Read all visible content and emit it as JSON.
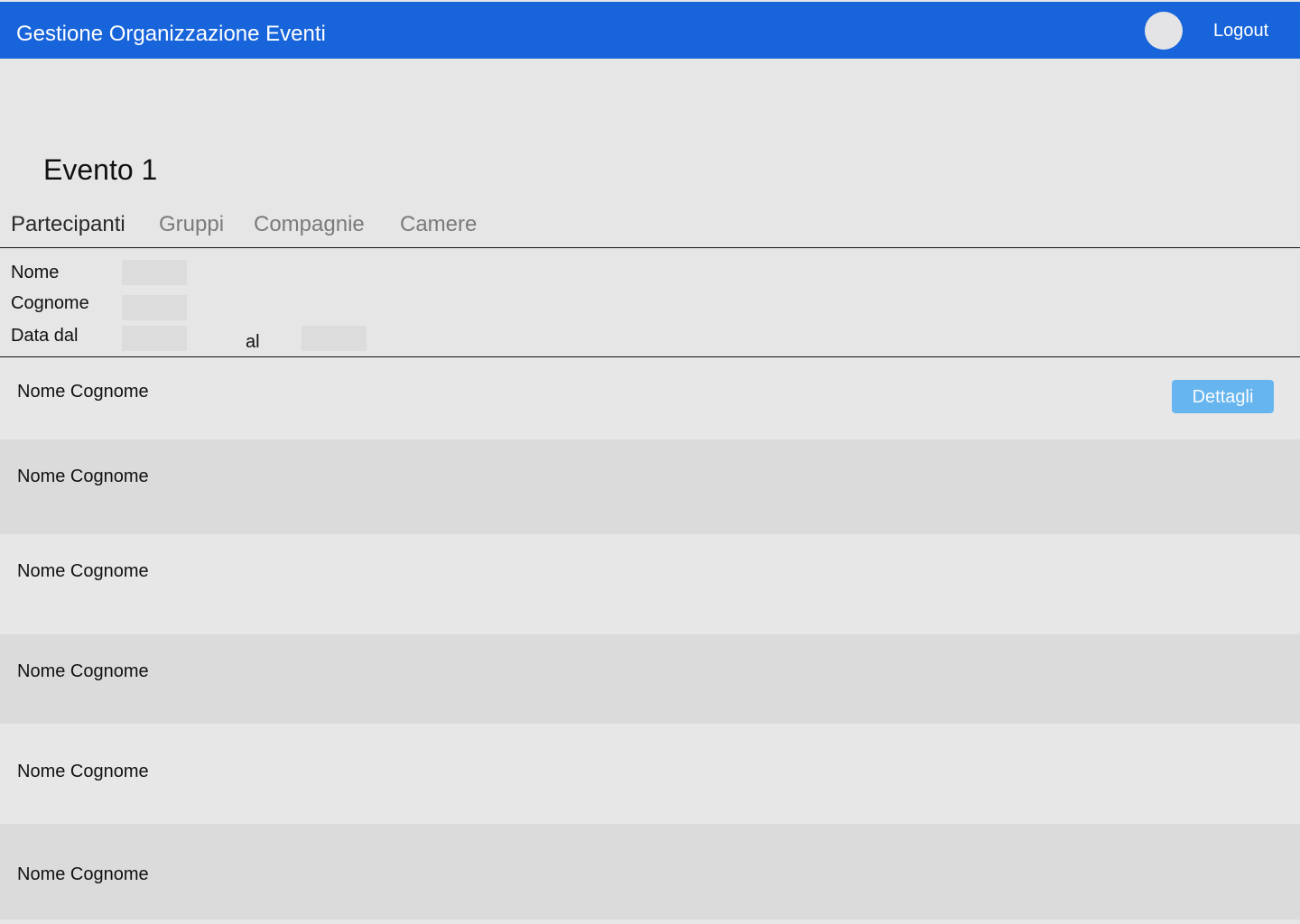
{
  "header": {
    "title": "Gestione Organizzazione Eventi",
    "avatar_icon": "avatar-circle-icon",
    "logout_label": "Logout",
    "background_color": "#1864db"
  },
  "event": {
    "title": "Evento 1"
  },
  "tabs": [
    {
      "label": "Partecipanti",
      "active": true
    },
    {
      "label": "Gruppi",
      "active": false
    },
    {
      "label": "Compagnie",
      "active": false
    },
    {
      "label": "Camere",
      "active": false
    }
  ],
  "filters": {
    "name_label": "Nome",
    "surname_label": "Cognome",
    "date_from_label": "Data dal",
    "date_to_label": "al",
    "name_value": "",
    "surname_value": "",
    "date_from_value": "",
    "date_to_value": ""
  },
  "participants": [
    {
      "name": "Nome Cognome",
      "action_label": "Dettagli"
    },
    {
      "name": "Nome Cognome"
    },
    {
      "name": "Nome Cognome"
    },
    {
      "name": "Nome Cognome"
    },
    {
      "name": "Nome Cognome"
    },
    {
      "name": "Nome Cognome"
    }
  ],
  "colors": {
    "page_background": "#e6e6e7",
    "row_light": "#e7e7e8",
    "row_dark": "#dbdbdc",
    "details_button": "#67b5ee"
  }
}
